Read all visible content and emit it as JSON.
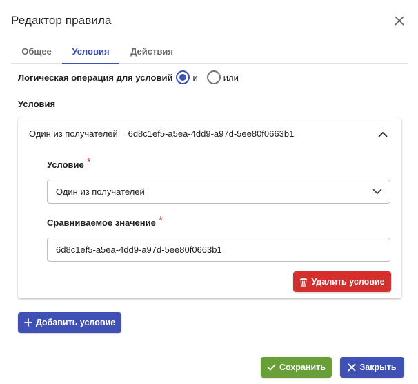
{
  "dialog": {
    "title": "Редактор правила",
    "close_icon": "close-icon"
  },
  "tabs": [
    {
      "label": "Общее",
      "active": false
    },
    {
      "label": "Условия",
      "active": true
    },
    {
      "label": "Действия",
      "active": false
    }
  ],
  "logic": {
    "label": "Логическая операция для условий",
    "options": [
      {
        "label": "и",
        "checked": true
      },
      {
        "label": "или",
        "checked": false
      }
    ]
  },
  "conditions": {
    "section_label": "Условия",
    "items": [
      {
        "summary": "Один из получателей = 6d8c1ef5-a5ea-4dd9-a97d-5ee80f0663b1",
        "expanded": true,
        "condition_label": "Условие",
        "condition_value": "Один из получателей",
        "compare_label": "Сравниваемое значение",
        "compare_value": "6d8c1ef5-a5ea-4dd9-a97d-5ee80f0663b1",
        "required_mark": "*",
        "delete_label": "Удалить условие"
      }
    ],
    "add_label": "Добавить условие"
  },
  "footer": {
    "save_label": "Сохранить",
    "close_label": "Закрыть"
  },
  "colors": {
    "primary": "#3f51b5",
    "danger": "#d32f2f",
    "success": "#689f38",
    "required": "#c62828"
  }
}
